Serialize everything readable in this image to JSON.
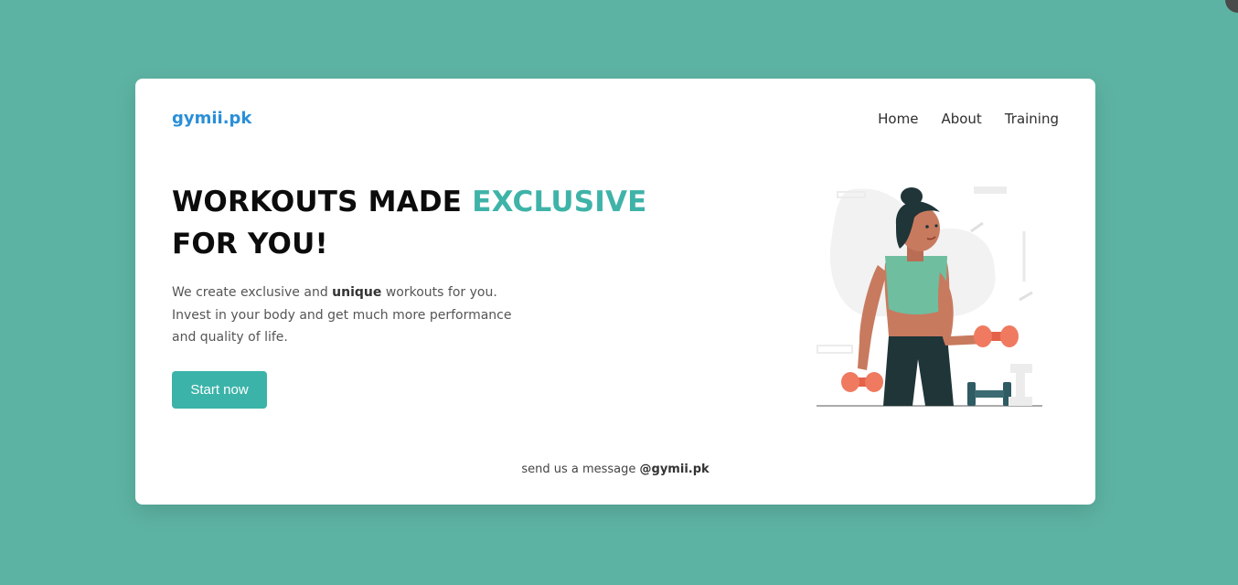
{
  "brand": {
    "name": "gymii.pk"
  },
  "nav": {
    "items": [
      {
        "label": "Home"
      },
      {
        "label": "About"
      },
      {
        "label": "Training"
      }
    ]
  },
  "hero": {
    "headline_part1": "WORKOUTS MADE ",
    "headline_accent": "EXCLUSIVE",
    "headline_part2": " FOR YOU!",
    "desc_part1": "We create exclusive and ",
    "desc_bold": "unique",
    "desc_part2": " workouts for you. Invest in your body and get much more performance and quality of life.",
    "cta_label": "Start now"
  },
  "footer": {
    "text": "send us a message ",
    "handle": "@gymii.pk"
  },
  "colors": {
    "background": "#5db3a3",
    "accent": "#3fb3a8",
    "brand": "#2a8fd8",
    "button": "#3cb3a9"
  },
  "illustration": {
    "icon": "woman-lifting-dumbbells-illustration"
  }
}
